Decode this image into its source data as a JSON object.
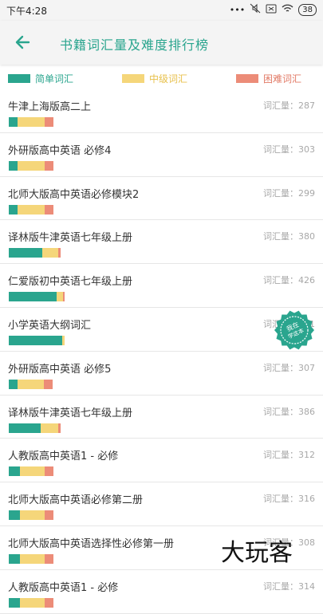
{
  "status": {
    "time": "下午4:28",
    "dots": "•••",
    "battery": "38"
  },
  "header": {
    "title": "书籍词汇量及难度排行榜"
  },
  "colors": {
    "simple": "#2aa58e",
    "medium": "#f5d67a",
    "hard": "#ec8c78",
    "accent": "#2aa58e"
  },
  "legend": [
    {
      "label": "简单词汇",
      "color": "#2aa58e",
      "text_color": "#2aa58e"
    },
    {
      "label": "中级词汇",
      "color": "#f5d67a",
      "text_color": "#e8c14c"
    },
    {
      "label": "困难词汇",
      "color": "#ec8c78",
      "text_color": "#e27b67"
    }
  ],
  "books": [
    {
      "name": "牛津上海版高二上",
      "count": "词汇量：287",
      "seg": [
        0.2,
        0.6,
        0.2
      ]
    },
    {
      "name": "外研版高中英语 必修4",
      "count": "词汇量：303",
      "seg": [
        0.2,
        0.6,
        0.2
      ]
    },
    {
      "name": "北师大版高中英语必修模块2",
      "count": "词汇量：299",
      "seg": [
        0.2,
        0.6,
        0.2
      ]
    },
    {
      "name": "译林版牛津英语七年级上册",
      "count": "词汇量：380",
      "seg": [
        0.65,
        0.3,
        0.05
      ]
    },
    {
      "name": "仁爱版初中英语七年级上册",
      "count": "词汇量：426",
      "seg": [
        0.85,
        0.12,
        0.03
      ]
    },
    {
      "name": "小学英语大纲词汇",
      "count": "词汇量：411",
      "seg": [
        0.95,
        0.05,
        0
      ]
    },
    {
      "name": "外研版高中英语 必修5",
      "count": "词汇量：307",
      "seg": [
        0.2,
        0.6,
        0.2
      ]
    },
    {
      "name": "译林版牛津英语七年级上册",
      "count": "词汇量：386",
      "seg": [
        0.62,
        0.33,
        0.05
      ]
    },
    {
      "name": "人教版高中英语1 - 必修",
      "count": "词汇量：312",
      "seg": [
        0.25,
        0.55,
        0.2
      ]
    },
    {
      "name": "北师大版高中英语必修第二册",
      "count": "词汇量：316",
      "seg": [
        0.25,
        0.55,
        0.2
      ]
    },
    {
      "name": "北师大版高中英语选择性必修第一册",
      "count": "词汇量：308",
      "seg": [
        0.25,
        0.55,
        0.2
      ]
    },
    {
      "name": "人教版高中英语1 - 必修",
      "count": "词汇量：314",
      "seg": [
        0.25,
        0.55,
        0.2
      ]
    }
  ],
  "bar_lengths": [
    0.8,
    0.8,
    0.8,
    0.93,
    1.0,
    1.0,
    0.78,
    0.93,
    0.8,
    0.8,
    0.8,
    0.8
  ],
  "stamp": {
    "text": "我在\n学这本"
  },
  "watermark": "大玩客"
}
